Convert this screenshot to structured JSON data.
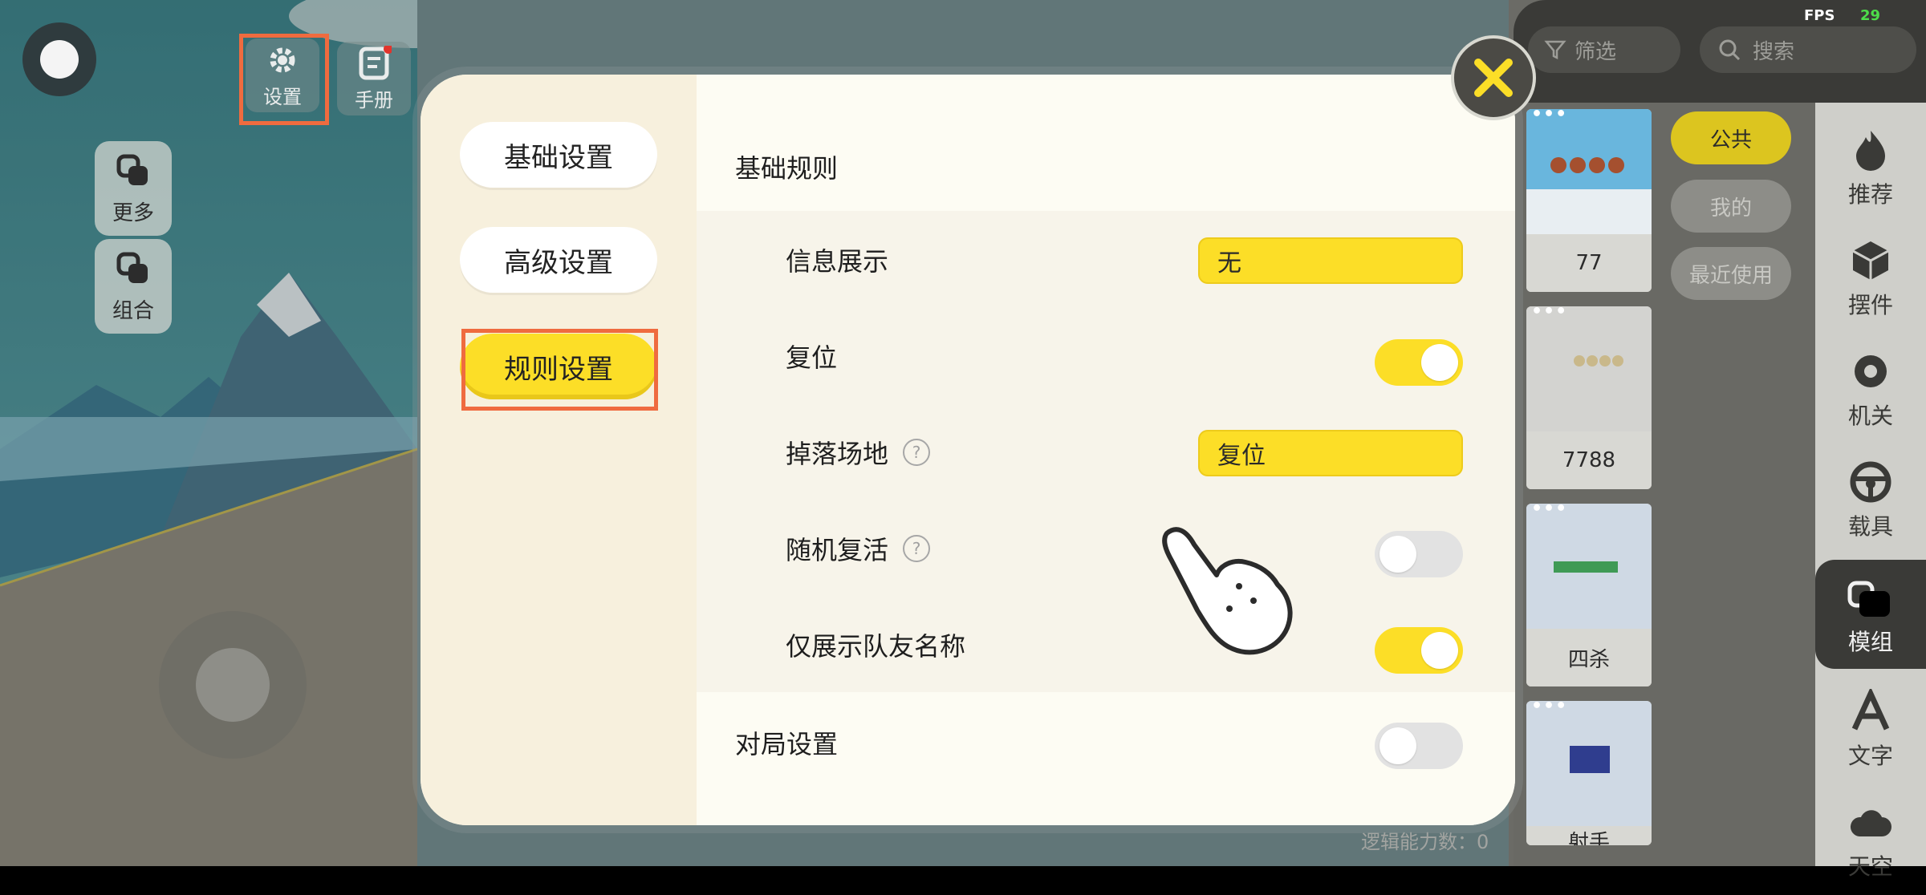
{
  "hud": {
    "settings_label": "设置",
    "handbook_label": "手册",
    "more_label": "更多",
    "combine_label": "组合"
  },
  "modal": {
    "nav": [
      {
        "label": "基础设置"
      },
      {
        "label": "高级设置"
      },
      {
        "label": "规则设置"
      }
    ],
    "section_basic_rules": "基础规则",
    "rows": {
      "info_display": {
        "label": "信息展示",
        "value": "无"
      },
      "reset": {
        "label": "复位",
        "on": true
      },
      "fall_ground": {
        "label": "掉落场地",
        "help": "?",
        "value": "复位"
      },
      "random_revive": {
        "label": "随机复活",
        "help": "?",
        "on": false
      },
      "teammate_names": {
        "label": "仅展示队友名称",
        "on": true
      }
    },
    "section_match_settings": "对局设置",
    "match_toggle_on": false
  },
  "right_panel": {
    "filter_label": "筛选",
    "search_placeholder": "搜索",
    "fps_label": "FPS",
    "fps_value": "29",
    "items": [
      {
        "caption": "77"
      },
      {
        "caption": "7788"
      },
      {
        "caption": "四杀"
      },
      {
        "caption": "射手"
      }
    ],
    "categories": [
      {
        "label": "公共"
      },
      {
        "label": "我的"
      },
      {
        "label": "最近使用"
      }
    ],
    "tabs": [
      {
        "label": "推荐",
        "icon": "flame-icon"
      },
      {
        "label": "摆件",
        "icon": "cube-icon"
      },
      {
        "label": "机关",
        "icon": "gear-icon"
      },
      {
        "label": "载具",
        "icon": "steering-wheel-icon"
      },
      {
        "label": "模组",
        "icon": "module-icon"
      },
      {
        "label": "文字",
        "icon": "text-icon"
      },
      {
        "label": "天空",
        "icon": "cloud-icon"
      }
    ]
  },
  "footer": {
    "logic_capacity": "逻辑能力数：0"
  },
  "colors": {
    "accent_yellow": "#fcde27",
    "highlight_orange": "#ef6b3f",
    "modal_bg": "#fdfcf3"
  }
}
